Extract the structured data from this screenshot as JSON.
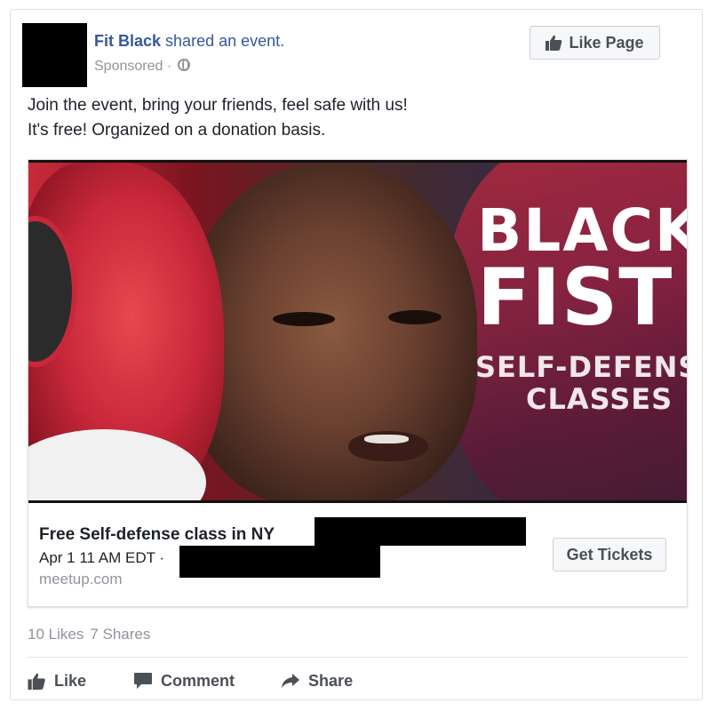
{
  "post": {
    "page_name": "Fit Black",
    "action_text": "shared an event.",
    "sponsored_label": "Sponsored",
    "meta_separator": "·",
    "like_page_label": "Like Page",
    "text_line_1": "Join the event, bring your friends, feel safe with us!",
    "text_line_2": "It's free! Organized on a donation basis."
  },
  "hero": {
    "title_line_1": "BLACK",
    "title_line_2": "FIST",
    "subtitle_line_1": "SELF-DEFENSE",
    "subtitle_line_2": "CLASSES"
  },
  "event": {
    "title": "Free Self-defense class in NY",
    "date": "Apr 1 11 AM EDT ·",
    "domain": "meetup.com",
    "tickets_label": "Get Tickets"
  },
  "stats": {
    "likes": "10 Likes",
    "shares": "7 Shares"
  },
  "actions": {
    "like": "Like",
    "comment": "Comment",
    "share": "Share"
  },
  "colors": {
    "link_blue": "#365899",
    "text_gray": "#90949c",
    "button_text": "#4b4f56"
  },
  "icons": {
    "globe": "globe-icon",
    "like_page": "thumbs-up-icon",
    "like": "thumbs-up-icon",
    "comment": "comment-icon",
    "share": "share-arrow-icon"
  }
}
